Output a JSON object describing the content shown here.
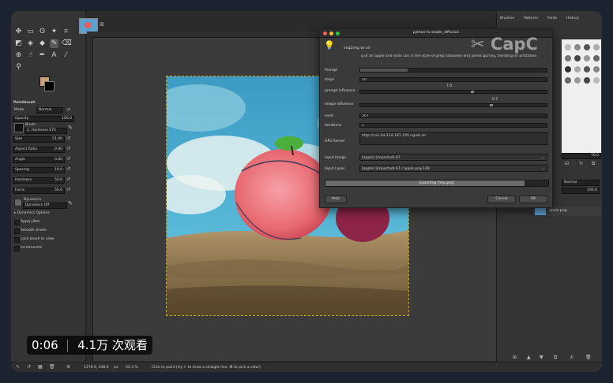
{
  "image_tab": {
    "close": "⊠"
  },
  "toolbox": {
    "panel_title": "Paintbrush",
    "mode_label": "Mode",
    "mode_value": "Normal",
    "opacity_label": "Opacity",
    "opacity_value": "100.0",
    "brush_label": "Brush",
    "brush_value": "2. Hardness 075",
    "size_label": "Size",
    "size_value": "51.00",
    "aspect_label": "Aspect Ratio",
    "aspect_value": "0.00",
    "angle_label": "Angle",
    "angle_value": "0.00",
    "spacing_label": "Spacing",
    "spacing_value": "10.0",
    "hardness_label": "Hardness",
    "hardness_value": "50.0",
    "force_label": "Force",
    "force_value": "50.0",
    "dynamics_label": "Dynamics",
    "dynamics_value": "Dynamics Off",
    "dynamics_options": "Dynamics Options",
    "apply_jitter": "Apply Jitter",
    "smooth_stroke": "Smooth stroke",
    "lock_brush": "Lock brush to view",
    "incremental": "Incremental"
  },
  "right_panel": {
    "tabs": [
      "Brushes",
      "Patterns",
      "Fonts",
      "History"
    ],
    "brush_size_value": "70.0",
    "layers_mode": "Normal",
    "layers_opacity": "100.0",
    "layer_name": "apple.png"
  },
  "dialog": {
    "title": "python-fu-stable_diffusion",
    "header_label": "img2img w/ sd",
    "prompt_text": "g of an apple and soda can in the style of greg rutkowski and james gurney, trending on artstation.",
    "prompt_label": "Prompt",
    "steps_label": "steps",
    "steps_value": "50",
    "prompt_influence_label": "prompt influence",
    "prompt_influence_value": "7.0",
    "prompt_influence_level": 0.6,
    "image_influence_label": "image influence",
    "image_influence_value": "0.7",
    "image_influence_level": 0.7,
    "seed_label": "seed",
    "seed_value": "567",
    "iterations_label": "iterations",
    "iterations_value": "1",
    "gpu_server_label": "GPU Server",
    "gpu_server_value": "http://ca2-34-124-187-195.ngrok.io/",
    "input_image_label": "Input Image",
    "input_image_value": "[apple] (imported)-67",
    "input_layer_label": "Input Layer",
    "input_layer_value": "[apple] (imported)-67 / apple.png-148",
    "progress_text": "Exporting 'tmp.png'",
    "progress_level": 0.9,
    "help_button": "Help",
    "cancel_button": "Cancel",
    "ok_button": "OK"
  },
  "status_bar": {
    "coords": "1278.0, 348.0",
    "unit": "px",
    "zoom": "34.3 %",
    "message": "Click to paint (try ⇧ to draw a straight line, ⌘ to pick a color)"
  },
  "watermark": "CapC",
  "video_overlay": {
    "time": "0:06",
    "views": "4.1万 次观看"
  }
}
